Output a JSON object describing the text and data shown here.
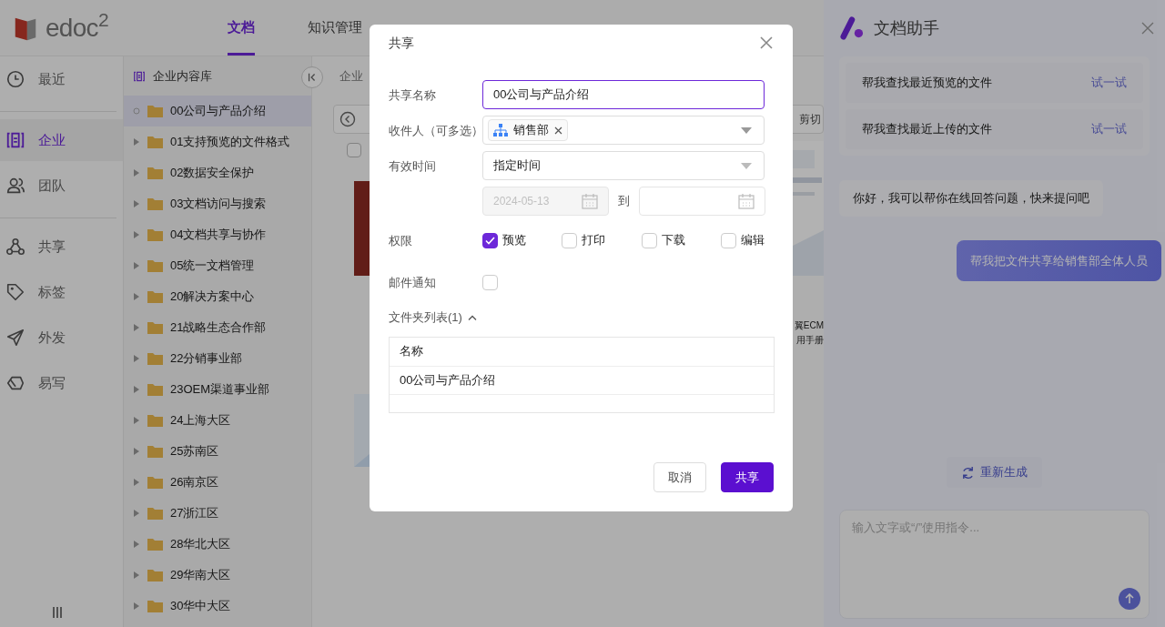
{
  "header": {
    "logo_text": "edoc$^{2}$",
    "nav_tabs": [
      {
        "label": "文档",
        "selected": true
      },
      {
        "label": "知识管理",
        "selected": false
      }
    ]
  },
  "sidebar": {
    "groups": [
      [
        {
          "label": "最近",
          "kind": "clock",
          "selected": false
        }
      ],
      [
        {
          "label": "企业",
          "kind": "library",
          "selected": true
        },
        {
          "label": "团队",
          "kind": "users",
          "selected": false
        }
      ],
      [
        {
          "label": "共享",
          "kind": "share",
          "selected": false
        },
        {
          "label": "标签",
          "kind": "tag",
          "selected": false
        },
        {
          "label": "外发",
          "kind": "send",
          "selected": false
        },
        {
          "label": "易写",
          "kind": "write",
          "selected": false
        }
      ]
    ]
  },
  "tree": {
    "title": "企业内容库",
    "items": [
      {
        "label": "00公司与产品介绍",
        "selected": true,
        "expandable": false
      },
      {
        "label": "01支持预览的文件格式",
        "selected": false,
        "expandable": true
      },
      {
        "label": "02数据安全保护",
        "selected": false,
        "expandable": true
      },
      {
        "label": "03文档访问与搜索",
        "selected": false,
        "expandable": true
      },
      {
        "label": "04文档共享与协作",
        "selected": false,
        "expandable": true
      },
      {
        "label": "05统一文档管理",
        "selected": false,
        "expandable": true
      },
      {
        "label": "20解决方案中心",
        "selected": false,
        "expandable": true
      },
      {
        "label": "21战略生态合作部",
        "selected": false,
        "expandable": true
      },
      {
        "label": "22分销事业部",
        "selected": false,
        "expandable": true
      },
      {
        "label": "23OEM渠道事业部",
        "selected": false,
        "expandable": true
      },
      {
        "label": "24上海大区",
        "selected": false,
        "expandable": true
      },
      {
        "label": "25苏南区",
        "selected": false,
        "expandable": true
      },
      {
        "label": "26南京区",
        "selected": false,
        "expandable": true
      },
      {
        "label": "27浙江区",
        "selected": false,
        "expandable": true
      },
      {
        "label": "28华北大区",
        "selected": false,
        "expandable": true
      },
      {
        "label": "29华南大区",
        "selected": false,
        "expandable": true
      },
      {
        "label": "30华中大区",
        "selected": false,
        "expandable": true
      }
    ]
  },
  "content": {
    "breadcrumb": "企业",
    "toolbar_right": "剪切",
    "select_all_checked": false,
    "card_name_lines": [
      "翼ECM",
      "用手册"
    ]
  },
  "share_dialog": {
    "title": "共享",
    "name_label": "共享名称",
    "name_value": "00公司与产品介绍",
    "recipients_label": "收件人（可多选）",
    "recipients": [
      {
        "label": "销售部"
      }
    ],
    "validity_label": "有效时间",
    "validity_value": "指定时间",
    "start_date": {
      "value": "2024-05-13",
      "disabled": true
    },
    "date_separator": "到",
    "permissions_label": "权限",
    "permissions": [
      {
        "label": "预览",
        "checked": true
      },
      {
        "label": "打印",
        "checked": false
      },
      {
        "label": "下载",
        "checked": false
      },
      {
        "label": "编辑",
        "checked": false
      }
    ],
    "email_label": "邮件通知",
    "email_checked": false,
    "folder_list_label": "文件夹列表(1)",
    "folder_list_expanded": true,
    "table": {
      "columns": [
        "名称"
      ],
      "rows": [
        [
          "00公司与产品介绍"
        ]
      ]
    },
    "buttons": [
      {
        "label": "取消",
        "kind": "secondary"
      },
      {
        "label": "共享",
        "kind": "primary"
      }
    ]
  },
  "assistant": {
    "title": "文档助手",
    "suggestions": [
      {
        "text": "帮我查找最近预览的文件",
        "action": "试一试"
      },
      {
        "text": "帮我查找最近上传的文件",
        "action": "试一试"
      }
    ],
    "messages": [
      {
        "kind": "bot",
        "text": "你好，我可以帮你在线回答问题，快来提问吧"
      },
      {
        "kind": "user",
        "text": "帮我把文件共享给销售部全体人员"
      }
    ],
    "regenerate": "重新生成",
    "input": {
      "placeholder": "输入文字或“/”使用指令..."
    }
  }
}
